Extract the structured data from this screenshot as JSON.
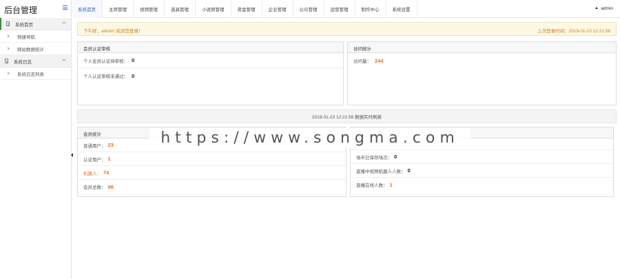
{
  "app": {
    "title": "后台管理"
  },
  "nav": {
    "tabs": [
      {
        "label": "系统首页",
        "active": true
      },
      {
        "label": "主席管理",
        "active": false
      },
      {
        "label": "视频管理",
        "active": false
      },
      {
        "label": "道具管理",
        "active": false
      },
      {
        "label": "小说频管理",
        "active": false
      },
      {
        "label": "资金管理",
        "active": false
      },
      {
        "label": "企业管理",
        "active": false
      },
      {
        "label": "公众管理",
        "active": false
      },
      {
        "label": "运营管理",
        "active": false
      },
      {
        "label": "制作中心",
        "active": false
      },
      {
        "label": "系统设置",
        "active": false
      }
    ],
    "user": "admin"
  },
  "sidebar": {
    "groups": [
      {
        "label": "系统首页",
        "active": true,
        "items": [
          "快捷导航",
          "网站数据统计"
        ]
      },
      {
        "label": "系统日志",
        "active": false,
        "items": [
          "系统日志列表"
        ]
      }
    ]
  },
  "alert": {
    "left": "下午好，admin! 欢迎您登录！",
    "right": "上次登录时间：2019-01-23 12:21:56"
  },
  "cert_panel": {
    "title": "会员认证审核",
    "rows": [
      {
        "label": "个人会员认证待审核：",
        "value": "0"
      },
      {
        "label": "个人认证审核未通过：",
        "value": "0"
      }
    ]
  },
  "visit_panel": {
    "title": "访问统计",
    "rows": [
      {
        "label": "访问量：",
        "value": "244"
      }
    ]
  },
  "refresh_bar": {
    "text": "2019-01-23 12:21:56 数据实时刷新"
  },
  "member_panel": {
    "title": "会员统计",
    "rows": [
      {
        "label": "普通用户：",
        "value": "23"
      },
      {
        "label": "认证用户：",
        "value": "1"
      },
      {
        "label": "机器人：",
        "value": "74"
      },
      {
        "label": "会员总数：",
        "value": "98"
      }
    ]
  },
  "live_panel": {
    "rows": [
      {
        "label": "场市已保存场次：",
        "value": "0"
      },
      {
        "label": "直播中视频机器人人数：",
        "value": "0"
      },
      {
        "label": "直播在线人数：",
        "value": "1"
      }
    ]
  },
  "watermark": {
    "text": "https://www.songma.com"
  },
  "colors": {
    "accent": "#2a64c8",
    "highlight": "#e96f23",
    "alert_bg": "#fcf8e3",
    "sidebar_active": "#3c8d3c"
  }
}
